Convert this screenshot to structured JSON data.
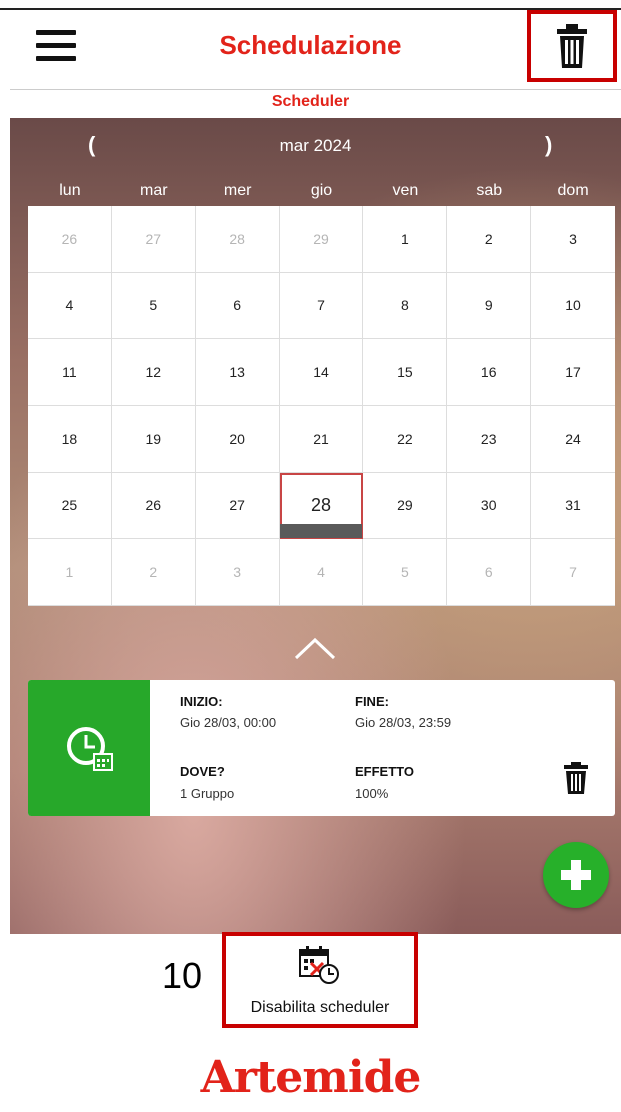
{
  "header": {
    "title": "Schedulazione",
    "subtitle": "Scheduler"
  },
  "calendar": {
    "month_label": "mar 2024",
    "prev": "(",
    "next": ")",
    "weekdays": [
      "lun",
      "mar",
      "mer",
      "gio",
      "ven",
      "sab",
      "dom"
    ],
    "days": [
      {
        "d": "26",
        "dim": true
      },
      {
        "d": "27",
        "dim": true
      },
      {
        "d": "28",
        "dim": true
      },
      {
        "d": "29",
        "dim": true
      },
      {
        "d": "1"
      },
      {
        "d": "2"
      },
      {
        "d": "3"
      },
      {
        "d": "4"
      },
      {
        "d": "5"
      },
      {
        "d": "6"
      },
      {
        "d": "7"
      },
      {
        "d": "8"
      },
      {
        "d": "9"
      },
      {
        "d": "10"
      },
      {
        "d": "11"
      },
      {
        "d": "12"
      },
      {
        "d": "13"
      },
      {
        "d": "14"
      },
      {
        "d": "15"
      },
      {
        "d": "16"
      },
      {
        "d": "17"
      },
      {
        "d": "18"
      },
      {
        "d": "19"
      },
      {
        "d": "20"
      },
      {
        "d": "21"
      },
      {
        "d": "22"
      },
      {
        "d": "23"
      },
      {
        "d": "24"
      },
      {
        "d": "25"
      },
      {
        "d": "26"
      },
      {
        "d": "27"
      },
      {
        "d": "28",
        "selected": true
      },
      {
        "d": "29"
      },
      {
        "d": "30"
      },
      {
        "d": "31"
      },
      {
        "d": "1",
        "dim": true
      },
      {
        "d": "2",
        "dim": true
      },
      {
        "d": "3",
        "dim": true
      },
      {
        "d": "4",
        "dim": true
      },
      {
        "d": "5",
        "dim": true
      },
      {
        "d": "6",
        "dim": true
      },
      {
        "d": "7",
        "dim": true
      }
    ]
  },
  "schedule": {
    "start_label": "INIZIO:",
    "start_value": "Gio 28/03, 00:00",
    "end_label": "FINE:",
    "end_value": "Gio 28/03, 23:59",
    "where_label": "DOVE?",
    "where_value": "1 Gruppo",
    "effect_label": "EFFETTO",
    "effect_value": "100%"
  },
  "footer": {
    "step_number": "10",
    "disable_label": "Disabilita scheduler",
    "logo_text": "Artemide"
  },
  "colors": {
    "accent": "#e2231a",
    "green": "#27a82a",
    "highlight_box": "#c80000"
  }
}
